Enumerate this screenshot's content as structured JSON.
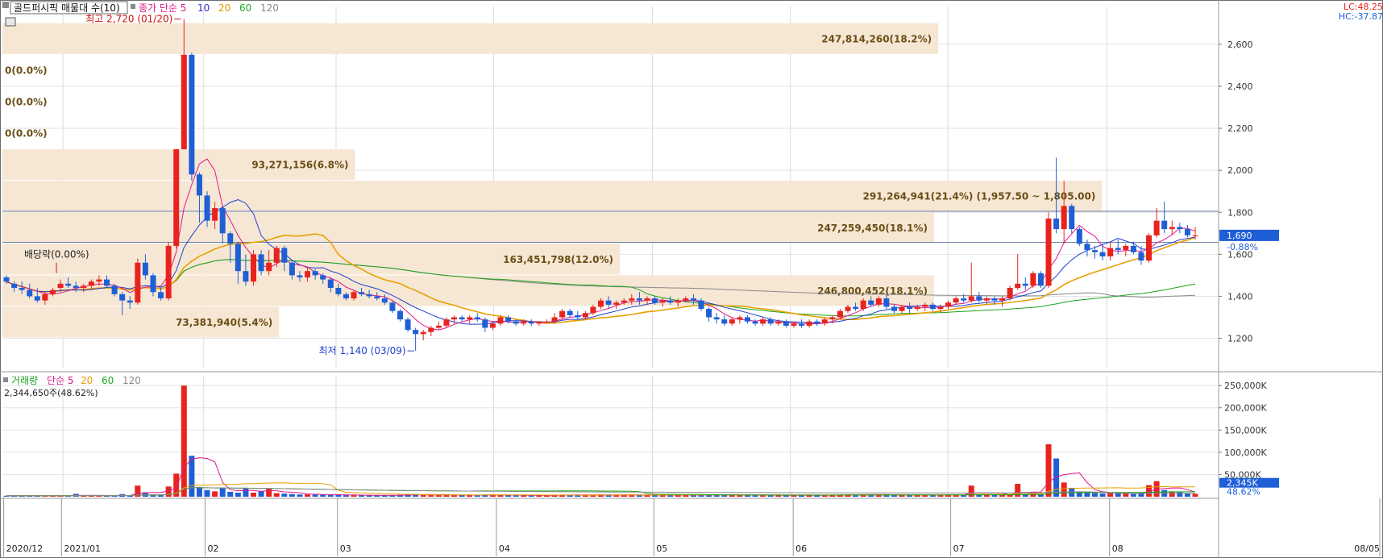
{
  "price_header": {
    "title": "골드퍼시픽 매물대 수(10)",
    "ma_label": "종가 단순",
    "periods": [
      "5",
      "10",
      "20",
      "60",
      "120"
    ],
    "period_colors": [
      "#3333cc",
      "#e89a00",
      "#22aa22",
      "#888888",
      "#777777"
    ]
  },
  "volume_header": {
    "title": "거래량",
    "ma_label": "단순",
    "periods": [
      "5",
      "20",
      "60",
      "120"
    ],
    "period_colors": [
      "#e89a00",
      "#22aa22",
      "#888888",
      "#777777"
    ],
    "current": "2,344,650주(48.62%)"
  },
  "corner": {
    "lc": "LC:48.25",
    "hc": "HC:-37.87"
  },
  "annotations": {
    "high": "최고 2,720 (01/20)",
    "low": "최저 1,140 (03/09)",
    "dividend": "배당락(0.00%)"
  },
  "current_price": {
    "value": "1,690",
    "change": "-0.88%"
  },
  "volume_current": {
    "value": "2,345K",
    "pct": "48.62%"
  },
  "colors": {
    "up": "#e8231e",
    "down": "#1f5fd6",
    "profile": "#f6e7d4",
    "profile_text": "#6b4e16"
  },
  "chart_data": {
    "type": "candlestick",
    "title": "골드퍼시픽",
    "price_axis": {
      "ylim": [
        1060,
        2780
      ],
      "ticks": [
        1200,
        1400,
        1600,
        1800,
        2000,
        2200,
        2400,
        2600
      ],
      "tick_labels": [
        "1,200",
        "1,400",
        "1,600",
        "1,800",
        "2,000",
        "2,200",
        "2,400",
        "2,600"
      ]
    },
    "volume_axis": {
      "ylim": [
        0,
        272000
      ],
      "ticks": [
        50000,
        100000,
        150000,
        200000,
        250000
      ],
      "tick_labels": [
        "50,000K",
        "100,000K",
        "150,000K",
        "200,000K",
        "250,000K"
      ]
    },
    "x_axis": {
      "labels": [
        "2020/12",
        "2021/01",
        "02",
        "03",
        "04",
        "05",
        "06",
        "07",
        "08",
        "08/05"
      ]
    },
    "volume_profile": [
      {
        "low": 2550,
        "high": 2700,
        "label": "247,814,260(18.2%)"
      },
      {
        "low": 2400,
        "high": 2550,
        "label": "0(0.0%)"
      },
      {
        "low": 2250,
        "high": 2400,
        "label": "0(0.0%)"
      },
      {
        "low": 2100,
        "high": 2250,
        "label": "0(0.0%)"
      },
      {
        "low": 1950,
        "high": 2100,
        "label": "93,271,156(6.8%)"
      },
      {
        "low": 1800,
        "high": 1950,
        "label": "291,264,941(21.4%) (1,957.50 ~ 1,805.00)"
      },
      {
        "low": 1650,
        "high": 1800,
        "label": "247,259,450(18.1%)"
      },
      {
        "low": 1500,
        "high": 1650,
        "label": "163,451,798(12.0%)"
      },
      {
        "low": 1350,
        "high": 1500,
        "label": "246,800,452(18.1%)"
      },
      {
        "low": 1200,
        "high": 1350,
        "label": "73,381,940(5.4%)"
      }
    ],
    "ohlc": [
      [
        1490,
        1500,
        1460,
        1470
      ],
      [
        1460,
        1470,
        1420,
        1440
      ],
      [
        1440,
        1470,
        1410,
        1430
      ],
      [
        1430,
        1460,
        1390,
        1400
      ],
      [
        1400,
        1440,
        1370,
        1380
      ],
      [
        1380,
        1420,
        1360,
        1410
      ],
      [
        1410,
        1440,
        1400,
        1430
      ],
      [
        1440,
        1480,
        1420,
        1460
      ],
      [
        1460,
        1490,
        1440,
        1450
      ],
      [
        1450,
        1470,
        1420,
        1440
      ],
      [
        1440,
        1460,
        1420,
        1450
      ],
      [
        1450,
        1480,
        1430,
        1470
      ],
      [
        1470,
        1500,
        1450,
        1480
      ],
      [
        1480,
        1500,
        1440,
        1450
      ],
      [
        1450,
        1460,
        1400,
        1410
      ],
      [
        1410,
        1420,
        1310,
        1380
      ],
      [
        1380,
        1400,
        1340,
        1370
      ],
      [
        1370,
        1580,
        1360,
        1560
      ],
      [
        1560,
        1600,
        1480,
        1500
      ],
      [
        1500,
        1510,
        1400,
        1420
      ],
      [
        1420,
        1440,
        1380,
        1390
      ],
      [
        1390,
        1660,
        1380,
        1640
      ],
      [
        1640,
        2100,
        1630,
        2100
      ],
      [
        2100,
        2720,
        2100,
        2550
      ],
      [
        2550,
        2560,
        1950,
        1980
      ],
      [
        1980,
        1990,
        1750,
        1880
      ],
      [
        1880,
        1900,
        1730,
        1760
      ],
      [
        1760,
        1850,
        1720,
        1820
      ],
      [
        1820,
        1830,
        1650,
        1700
      ],
      [
        1700,
        1710,
        1560,
        1650
      ],
      [
        1650,
        1660,
        1460,
        1520
      ],
      [
        1520,
        1600,
        1450,
        1470
      ],
      [
        1470,
        1620,
        1450,
        1600
      ],
      [
        1600,
        1620,
        1500,
        1520
      ],
      [
        1520,
        1620,
        1500,
        1560
      ],
      [
        1560,
        1640,
        1540,
        1630
      ],
      [
        1630,
        1640,
        1520,
        1560
      ],
      [
        1560,
        1570,
        1480,
        1500
      ],
      [
        1500,
        1520,
        1470,
        1490
      ],
      [
        1490,
        1540,
        1470,
        1520
      ],
      [
        1520,
        1530,
        1480,
        1500
      ],
      [
        1500,
        1510,
        1460,
        1480
      ],
      [
        1480,
        1490,
        1420,
        1440
      ],
      [
        1440,
        1460,
        1400,
        1410
      ],
      [
        1410,
        1420,
        1380,
        1390
      ],
      [
        1390,
        1430,
        1380,
        1420
      ],
      [
        1420,
        1440,
        1400,
        1410
      ],
      [
        1410,
        1430,
        1390,
        1400
      ],
      [
        1400,
        1420,
        1380,
        1390
      ],
      [
        1390,
        1410,
        1360,
        1370
      ],
      [
        1370,
        1380,
        1320,
        1330
      ],
      [
        1330,
        1340,
        1280,
        1290
      ],
      [
        1290,
        1300,
        1230,
        1240
      ],
      [
        1240,
        1250,
        1140,
        1220
      ],
      [
        1220,
        1240,
        1190,
        1230
      ],
      [
        1230,
        1260,
        1210,
        1250
      ],
      [
        1250,
        1280,
        1240,
        1260
      ],
      [
        1260,
        1300,
        1250,
        1290
      ],
      [
        1290,
        1310,
        1270,
        1300
      ],
      [
        1300,
        1310,
        1280,
        1290
      ],
      [
        1290,
        1310,
        1270,
        1300
      ],
      [
        1300,
        1320,
        1280,
        1290
      ],
      [
        1290,
        1300,
        1230,
        1250
      ],
      [
        1250,
        1280,
        1240,
        1270
      ],
      [
        1270,
        1310,
        1260,
        1300
      ],
      [
        1300,
        1310,
        1270,
        1280
      ],
      [
        1280,
        1290,
        1260,
        1270
      ],
      [
        1270,
        1290,
        1260,
        1280
      ],
      [
        1280,
        1290,
        1260,
        1270
      ],
      [
        1270,
        1280,
        1260,
        1280
      ],
      [
        1280,
        1290,
        1270,
        1280
      ],
      [
        1280,
        1320,
        1270,
        1300
      ],
      [
        1300,
        1340,
        1290,
        1330
      ],
      [
        1330,
        1340,
        1300,
        1310
      ],
      [
        1310,
        1330,
        1290,
        1300
      ],
      [
        1300,
        1330,
        1290,
        1320
      ],
      [
        1320,
        1360,
        1310,
        1350
      ],
      [
        1350,
        1390,
        1340,
        1380
      ],
      [
        1380,
        1400,
        1340,
        1360
      ],
      [
        1360,
        1380,
        1340,
        1370
      ],
      [
        1370,
        1390,
        1360,
        1380
      ],
      [
        1380,
        1410,
        1360,
        1390
      ],
      [
        1390,
        1420,
        1360,
        1380
      ],
      [
        1380,
        1400,
        1360,
        1390
      ],
      [
        1390,
        1400,
        1360,
        1370
      ],
      [
        1370,
        1390,
        1350,
        1380
      ],
      [
        1380,
        1400,
        1360,
        1370
      ],
      [
        1370,
        1390,
        1350,
        1380
      ],
      [
        1380,
        1400,
        1370,
        1390
      ],
      [
        1390,
        1410,
        1360,
        1380
      ],
      [
        1380,
        1390,
        1330,
        1340
      ],
      [
        1340,
        1350,
        1280,
        1300
      ],
      [
        1300,
        1320,
        1270,
        1290
      ],
      [
        1290,
        1310,
        1260,
        1270
      ],
      [
        1270,
        1300,
        1260,
        1290
      ],
      [
        1290,
        1310,
        1270,
        1300
      ],
      [
        1300,
        1310,
        1270,
        1280
      ],
      [
        1280,
        1290,
        1260,
        1270
      ],
      [
        1270,
        1300,
        1260,
        1290
      ],
      [
        1290,
        1300,
        1260,
        1270
      ],
      [
        1270,
        1290,
        1260,
        1280
      ],
      [
        1280,
        1290,
        1250,
        1260
      ],
      [
        1260,
        1280,
        1250,
        1270
      ],
      [
        1270,
        1290,
        1250,
        1260
      ],
      [
        1260,
        1290,
        1250,
        1280
      ],
      [
        1280,
        1290,
        1260,
        1270
      ],
      [
        1270,
        1300,
        1260,
        1290
      ],
      [
        1290,
        1310,
        1270,
        1300
      ],
      [
        1300,
        1340,
        1290,
        1330
      ],
      [
        1330,
        1360,
        1320,
        1350
      ],
      [
        1350,
        1370,
        1330,
        1340
      ],
      [
        1340,
        1390,
        1330,
        1380
      ],
      [
        1380,
        1400,
        1350,
        1360
      ],
      [
        1360,
        1400,
        1350,
        1390
      ],
      [
        1390,
        1410,
        1340,
        1350
      ],
      [
        1350,
        1360,
        1320,
        1330
      ],
      [
        1330,
        1360,
        1320,
        1350
      ],
      [
        1350,
        1370,
        1320,
        1340
      ],
      [
        1340,
        1360,
        1330,
        1350
      ],
      [
        1350,
        1370,
        1330,
        1360
      ],
      [
        1360,
        1370,
        1330,
        1340
      ],
      [
        1340,
        1360,
        1320,
        1350
      ],
      [
        1350,
        1380,
        1340,
        1370
      ],
      [
        1370,
        1400,
        1360,
        1390
      ],
      [
        1390,
        1410,
        1370,
        1380
      ],
      [
        1380,
        1560,
        1370,
        1400
      ],
      [
        1400,
        1420,
        1370,
        1380
      ],
      [
        1380,
        1400,
        1360,
        1390
      ],
      [
        1390,
        1400,
        1360,
        1380
      ],
      [
        1380,
        1400,
        1350,
        1390
      ],
      [
        1390,
        1450,
        1380,
        1440
      ],
      [
        1440,
        1600,
        1430,
        1460
      ],
      [
        1460,
        1490,
        1430,
        1450
      ],
      [
        1450,
        1520,
        1440,
        1510
      ],
      [
        1510,
        1520,
        1440,
        1450
      ],
      [
        1450,
        1800,
        1440,
        1770
      ],
      [
        1770,
        2060,
        1700,
        1720
      ],
      [
        1720,
        1950,
        1650,
        1830
      ],
      [
        1830,
        1840,
        1700,
        1720
      ],
      [
        1720,
        1730,
        1640,
        1650
      ],
      [
        1650,
        1670,
        1590,
        1620
      ],
      [
        1620,
        1640,
        1580,
        1610
      ],
      [
        1610,
        1650,
        1570,
        1590
      ],
      [
        1590,
        1660,
        1570,
        1630
      ],
      [
        1630,
        1670,
        1600,
        1620
      ],
      [
        1620,
        1650,
        1590,
        1640
      ],
      [
        1640,
        1660,
        1600,
        1610
      ],
      [
        1610,
        1640,
        1550,
        1570
      ],
      [
        1570,
        1700,
        1560,
        1690
      ],
      [
        1690,
        1820,
        1680,
        1760
      ],
      [
        1760,
        1850,
        1700,
        1720
      ],
      [
        1720,
        1760,
        1690,
        1730
      ],
      [
        1730,
        1750,
        1700,
        1720
      ],
      [
        1720,
        1740,
        1680,
        1690
      ],
      [
        1690,
        1730,
        1670,
        1690
      ]
    ],
    "volume": [
      2200,
      2400,
      1800,
      2600,
      1900,
      2800,
      2100,
      2300,
      1700,
      6500,
      2100,
      2400,
      1900,
      2000,
      2200,
      5800,
      2000,
      25000,
      9800,
      5000,
      4800,
      23000,
      52000,
      250000,
      92000,
      22000,
      15000,
      12000,
      20000,
      11000,
      9000,
      20000,
      9000,
      12000,
      18000,
      8000,
      7000,
      6000,
      5000,
      5200,
      4800,
      4500,
      4200,
      4000,
      3600,
      3400,
      3200,
      3100,
      3000,
      3100,
      3500,
      4200,
      5000,
      6000,
      5200,
      4000,
      3800,
      4200,
      3500,
      3800,
      3600,
      3400,
      4800,
      4000,
      3500,
      3300,
      3100,
      3000,
      3200,
      3000,
      3200,
      4000,
      4600,
      4200,
      3600,
      3700,
      4200,
      5000,
      4400,
      4000,
      3900,
      4200,
      4600,
      4100,
      3900,
      3700,
      3900,
      3600,
      3800,
      3800,
      4200,
      5000,
      4400,
      4000,
      3800,
      3600,
      3900,
      3500,
      3700,
      3400,
      3500,
      3300,
      3600,
      3400,
      3500,
      3300,
      3700,
      3900,
      4600,
      5000,
      4200,
      5200,
      4600,
      4900,
      4300,
      3900,
      4100,
      3800,
      4000,
      4100,
      3600,
      3800,
      4200,
      5000,
      4600,
      25000,
      4200,
      3900,
      4300,
      4600,
      5000,
      29000,
      5200,
      8000,
      4800,
      118000,
      86000,
      32000,
      20000,
      12000,
      9000,
      8000,
      7000,
      10000,
      7500,
      8200,
      6000,
      10000,
      26000,
      35000,
      15000,
      12000,
      11000,
      8000,
      6500
    ],
    "ma_price": [
      {
        "name": "5",
        "color": "#e0188a"
      },
      {
        "name": "10",
        "color": "#1f3fd0"
      },
      {
        "name": "20",
        "color": "#e8a000"
      },
      {
        "name": "60",
        "color": "#1aa31a"
      },
      {
        "name": "120",
        "color": "#888888"
      }
    ]
  }
}
